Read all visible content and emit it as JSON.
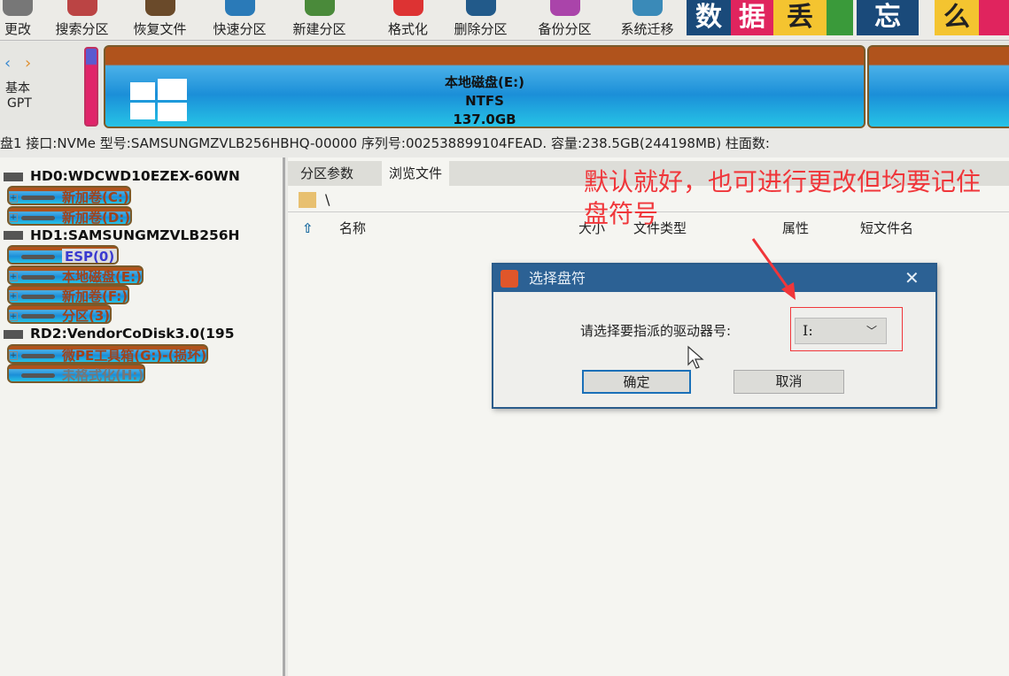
{
  "toolbar": {
    "items": [
      {
        "label": "更改",
        "color": "#777"
      },
      {
        "label": "搜索分区",
        "color": "#b44"
      },
      {
        "label": "恢复文件",
        "color": "#6a4a2a"
      },
      {
        "label": "快速分区",
        "color": "#2a7ab8"
      },
      {
        "label": "新建分区",
        "color": "#4a8a3a"
      },
      {
        "label": "格式化",
        "color": "#d33"
      },
      {
        "label": "删除分区",
        "color": "#225a8a"
      },
      {
        "label": "备份分区",
        "color": "#a4a"
      },
      {
        "label": "系统迁移",
        "color": "#3a8ab8"
      }
    ]
  },
  "banner": {
    "tiles": [
      "数",
      "据",
      "丢",
      "",
      "忘",
      "么"
    ]
  },
  "diskmap": {
    "nav_line1": "基本",
    "nav_line2": "GPT",
    "partition": {
      "name": "本地磁盘(E:)",
      "fs": "NTFS",
      "size": "137.0GB"
    }
  },
  "info_line": "盘1 接口:NVMe  型号:SAMSUNGMZVLB256HBHQ-00000  序列号:002538899104FEAD.  容量:238.5GB(244198MB)  柱面数:",
  "tree": [
    {
      "type": "disk",
      "label": "HD0:WDCWD10EZEX-60WN"
    },
    {
      "type": "part",
      "label": "新加卷(C:)",
      "expand": true
    },
    {
      "type": "part",
      "label": "新加卷(D:)",
      "expand": true
    },
    {
      "type": "disk",
      "label": "HD1:SAMSUNGMZVLB256H"
    },
    {
      "type": "part",
      "label": "ESP(0)",
      "expand": false,
      "selected": true
    },
    {
      "type": "part",
      "label": "本地磁盘(E:)",
      "expand": true
    },
    {
      "type": "part",
      "label": "新加卷(F:)",
      "expand": true
    },
    {
      "type": "part",
      "label": "分区(3)",
      "expand": true
    },
    {
      "type": "disk",
      "label": "RD2:VendorCoDisk3.0(195"
    },
    {
      "type": "part",
      "label": "微PE工具箱(G:)-(损坏)",
      "expand": true
    },
    {
      "type": "part",
      "label": "未格式化(H:)",
      "expand": false,
      "gray": true
    }
  ],
  "tabs": [
    "分区参数",
    "浏览文件"
  ],
  "path": "\\",
  "columns": [
    "名称",
    "大小",
    "文件类型",
    "属性",
    "短文件名"
  ],
  "dialog": {
    "title": "选择盘符",
    "label": "请选择要指派的驱动器号:",
    "value": "I:",
    "ok": "确定",
    "cancel": "取消"
  },
  "annotation": {
    "text": "默认就好，也可进行更改但均要记住盘符号",
    "color": "#f0363a"
  }
}
